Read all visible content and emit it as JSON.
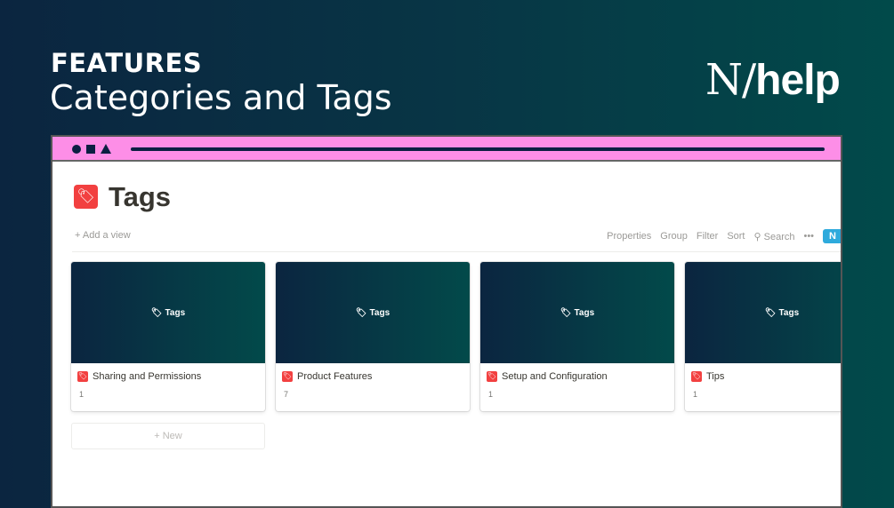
{
  "slide": {
    "eyebrow": "FEATURES",
    "headline": "Categories and Tags",
    "logo": "N/help"
  },
  "page": {
    "title": "Tags",
    "add_view": "+ Add a view"
  },
  "toolbar": {
    "properties": "Properties",
    "group": "Group",
    "filter": "Filter",
    "sort": "Sort",
    "search": "Search",
    "more": "•••",
    "new": "N"
  },
  "cards": [
    {
      "cover": "Tags",
      "name": "Sharing and Permissions",
      "count": "1"
    },
    {
      "cover": "Tags",
      "name": "Product Features",
      "count": "7"
    },
    {
      "cover": "Tags",
      "name": "Setup and Configuration",
      "count": "1"
    },
    {
      "cover": "Tags",
      "name": "Tips",
      "count": "1"
    }
  ],
  "add_new": "+ New",
  "colors": {
    "accent_pink": "#fd8ee7",
    "tag_red": "#f24040",
    "new_blue": "#2eaadc",
    "navy": "#0b2540",
    "teal": "#014a4a"
  }
}
